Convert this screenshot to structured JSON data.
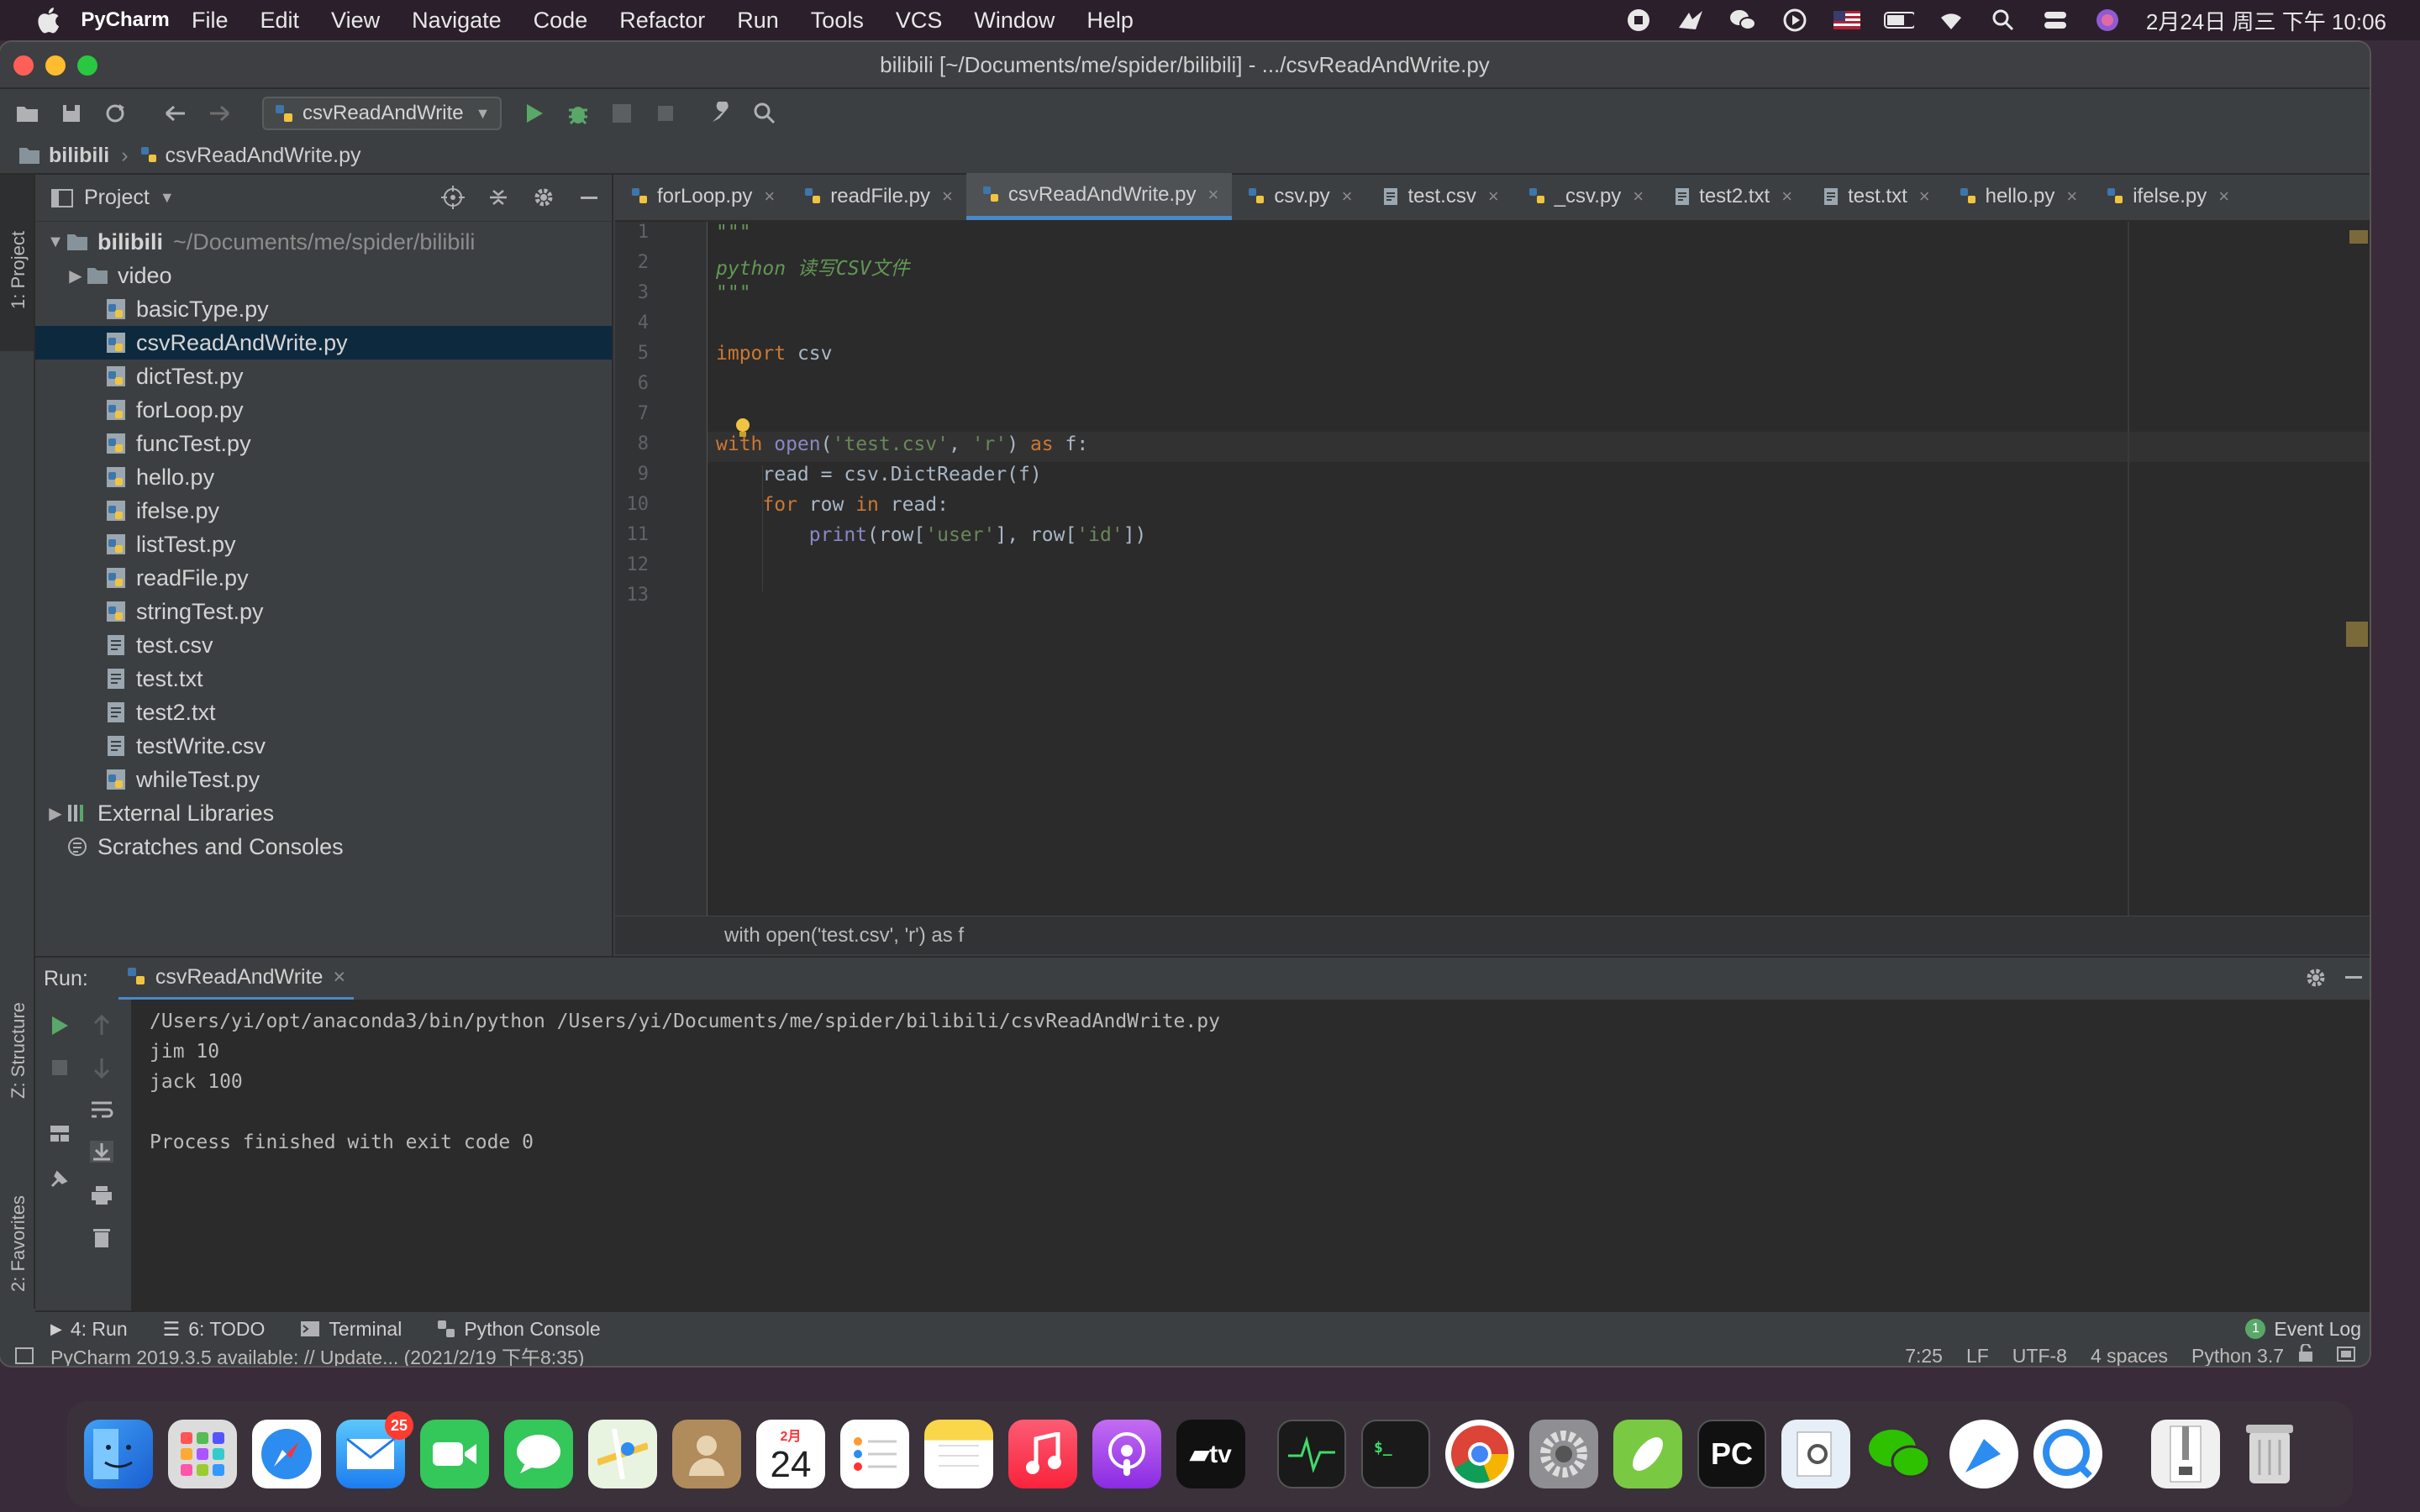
{
  "menubar": {
    "app_name": "PyCharm",
    "items": [
      "File",
      "Edit",
      "View",
      "Navigate",
      "Code",
      "Refactor",
      "Run",
      "Tools",
      "VCS",
      "Window",
      "Help"
    ],
    "clock": "2月24日 周三 下午 10:06"
  },
  "window": {
    "title": "bilibili [~/Documents/me/spider/bilibili] - .../csvReadAndWrite.py"
  },
  "toolbar": {
    "run_config": "csvReadAndWrite"
  },
  "breadcrumb": {
    "project": "bilibili",
    "file": "csvReadAndWrite.py"
  },
  "sidebar": {
    "project_tab": "1: Project",
    "structure_tab": "Z: Structure",
    "favorites_tab": "2: Favorites"
  },
  "project_panel": {
    "title": "Project",
    "root_name": "bilibili",
    "root_path": "~/Documents/me/spider/bilibili",
    "items": [
      {
        "name": "video",
        "type": "folder"
      },
      {
        "name": "basicType.py",
        "type": "py"
      },
      {
        "name": "csvReadAndWrite.py",
        "type": "py"
      },
      {
        "name": "dictTest.py",
        "type": "py"
      },
      {
        "name": "forLoop.py",
        "type": "py"
      },
      {
        "name": "funcTest.py",
        "type": "py"
      },
      {
        "name": "hello.py",
        "type": "py"
      },
      {
        "name": "ifelse.py",
        "type": "py"
      },
      {
        "name": "listTest.py",
        "type": "py"
      },
      {
        "name": "readFile.py",
        "type": "py"
      },
      {
        "name": "stringTest.py",
        "type": "py"
      },
      {
        "name": "test.csv",
        "type": "txt"
      },
      {
        "name": "test.txt",
        "type": "txt"
      },
      {
        "name": "test2.txt",
        "type": "txt"
      },
      {
        "name": "testWrite.csv",
        "type": "txt"
      },
      {
        "name": "whileTest.py",
        "type": "py"
      }
    ],
    "external_libraries": "External Libraries",
    "scratches": "Scratches and Consoles"
  },
  "editor": {
    "tabs": [
      "forLoop.py",
      "readFile.py",
      "csvReadAndWrite.py",
      "csv.py",
      "test.csv",
      "_csv.py",
      "test2.txt",
      "test.txt",
      "hello.py",
      "ifelse.py"
    ],
    "active_tab": "csvReadAndWrite.py",
    "line_numbers": [
      "1",
      "2",
      "3",
      "4",
      "5",
      "6",
      "7",
      "8",
      "9",
      "10",
      "11",
      "12",
      "13"
    ],
    "code": {
      "l1": "\"\"\"",
      "l2": "python 读写CSV文件",
      "l3": "\"\"\"",
      "l5_kw": "import",
      "l5_rest": " csv",
      "l7_with": "with",
      "l7_open": " open",
      "l7_p1": "(",
      "l7_s1": "'test.csv'",
      "l7_p2": ", ",
      "l7_s2": "'r'",
      "l7_p3": ") ",
      "l7_as": "as",
      "l7_p4": " f:",
      "l8": "    read = csv.DictReader(f)",
      "l9_for": "    for",
      "l9_row": " row ",
      "l9_in": "in",
      "l9_rest": " read:",
      "l10_print": "        print",
      "l10_p1": "(row[",
      "l10_s1": "'user'",
      "l10_p2": "], row[",
      "l10_s2": "'id'",
      "l10_p3": "])"
    },
    "status_hint": "with open('test.csv', 'r') as f"
  },
  "run_panel": {
    "label": "Run:",
    "tab": "csvReadAndWrite",
    "output": [
      "/Users/yi/opt/anaconda3/bin/python /Users/yi/Documents/me/spider/bilibili/csvReadAndWrite.py",
      "jim 10",
      "jack 100",
      "",
      "Process finished with exit code 0"
    ]
  },
  "bottom_tabs": {
    "run": "4: Run",
    "todo": "6: TODO",
    "terminal": "Terminal",
    "python_console": "Python Console",
    "event_log": "Event Log",
    "event_count": "1"
  },
  "statusbar": {
    "message": "PyCharm 2019.3.5 available: // Update... (2021/2/19 下午8:35)",
    "position": "7:25",
    "line_sep": "LF",
    "encoding": "UTF-8",
    "indent": "4 spaces",
    "interpreter": "Python 3.7"
  },
  "dock": {
    "mail_badge": "25",
    "calendar_month": "2月",
    "calendar_day": "24",
    "apps": [
      "finder",
      "launchpad",
      "safari",
      "mail",
      "facetime",
      "messages",
      "maps",
      "contacts",
      "calendar",
      "reminders",
      "notes",
      "music",
      "podcasts",
      "tv",
      "activity-monitor",
      "terminal",
      "chrome",
      "system-preferences",
      "sequel",
      "pycharm",
      "preview",
      "wechat",
      "feather",
      "quicktime",
      "archive",
      "trash"
    ]
  },
  "colors": {
    "accent": "#4a88c7",
    "keyword": "#cc7832",
    "string": "#6a8759",
    "editor_bg": "#2b2b2b"
  }
}
